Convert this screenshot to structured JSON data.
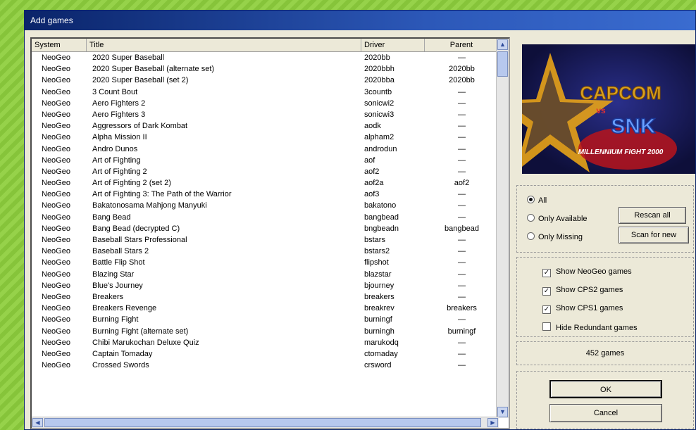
{
  "window": {
    "title": "Add games"
  },
  "list": {
    "columns": [
      "System",
      "Title",
      "Driver",
      "Parent"
    ],
    "rows": [
      {
        "system": "NeoGeo",
        "title": "2020 Super Baseball",
        "driver": "2020bb",
        "parent": "—"
      },
      {
        "system": "NeoGeo",
        "title": "2020 Super Baseball (alternate set)",
        "driver": "2020bbh",
        "parent": "2020bb"
      },
      {
        "system": "NeoGeo",
        "title": "2020 Super Baseball (set 2)",
        "driver": "2020bba",
        "parent": "2020bb"
      },
      {
        "system": "NeoGeo",
        "title": "3 Count Bout",
        "driver": "3countb",
        "parent": "—"
      },
      {
        "system": "NeoGeo",
        "title": "Aero Fighters 2",
        "driver": "sonicwi2",
        "parent": "—"
      },
      {
        "system": "NeoGeo",
        "title": "Aero Fighters 3",
        "driver": "sonicwi3",
        "parent": "—"
      },
      {
        "system": "NeoGeo",
        "title": "Aggressors of Dark Kombat",
        "driver": "aodk",
        "parent": "—"
      },
      {
        "system": "NeoGeo",
        "title": "Alpha Mission II",
        "driver": "alpham2",
        "parent": "—"
      },
      {
        "system": "NeoGeo",
        "title": "Andro Dunos",
        "driver": "androdun",
        "parent": "—"
      },
      {
        "system": "NeoGeo",
        "title": "Art of Fighting",
        "driver": "aof",
        "parent": "—"
      },
      {
        "system": "NeoGeo",
        "title": "Art of Fighting 2",
        "driver": "aof2",
        "parent": "—"
      },
      {
        "system": "NeoGeo",
        "title": "Art of Fighting 2 (set 2)",
        "driver": "aof2a",
        "parent": "aof2"
      },
      {
        "system": "NeoGeo",
        "title": "Art of Fighting 3: The Path of the Warrior",
        "driver": "aof3",
        "parent": "—"
      },
      {
        "system": "NeoGeo",
        "title": "Bakatonosama Mahjong Manyuki",
        "driver": "bakatono",
        "parent": "—"
      },
      {
        "system": "NeoGeo",
        "title": "Bang Bead",
        "driver": "bangbead",
        "parent": "—"
      },
      {
        "system": "NeoGeo",
        "title": "Bang Bead (decrypted C)",
        "driver": "bngbeadn",
        "parent": "bangbead"
      },
      {
        "system": "NeoGeo",
        "title": "Baseball Stars Professional",
        "driver": "bstars",
        "parent": "—"
      },
      {
        "system": "NeoGeo",
        "title": "Baseball Stars 2",
        "driver": "bstars2",
        "parent": "—"
      },
      {
        "system": "NeoGeo",
        "title": "Battle Flip Shot",
        "driver": "flipshot",
        "parent": "—"
      },
      {
        "system": "NeoGeo",
        "title": "Blazing Star",
        "driver": "blazstar",
        "parent": "—"
      },
      {
        "system": "NeoGeo",
        "title": "Blue's Journey",
        "driver": "bjourney",
        "parent": "—"
      },
      {
        "system": "NeoGeo",
        "title": "Breakers",
        "driver": "breakers",
        "parent": "—"
      },
      {
        "system": "NeoGeo",
        "title": "Breakers Revenge",
        "driver": "breakrev",
        "parent": "breakers"
      },
      {
        "system": "NeoGeo",
        "title": "Burning Fight",
        "driver": "burningf",
        "parent": "—"
      },
      {
        "system": "NeoGeo",
        "title": "Burning Fight (alternate set)",
        "driver": "burningh",
        "parent": "burningf"
      },
      {
        "system": "NeoGeo",
        "title": "Chibi Marukochan Deluxe Quiz",
        "driver": "marukodq",
        "parent": "—"
      },
      {
        "system": "NeoGeo",
        "title": "Captain Tomaday",
        "driver": "ctomaday",
        "parent": "—"
      },
      {
        "system": "NeoGeo",
        "title": "Crossed Swords",
        "driver": "crsword",
        "parent": "—"
      }
    ]
  },
  "preview": {
    "logo_top": "CAPCOM",
    "logo_vs": "vs",
    "logo_bottom": "SNK",
    "logo_caption": "MILLENNIUM FIGHT 2000"
  },
  "filter": {
    "options": [
      {
        "label": "All",
        "selected": true
      },
      {
        "label": "Only Available",
        "selected": false
      },
      {
        "label": "Only Missing",
        "selected": false
      }
    ],
    "rescan_label": "Rescan all",
    "scan_new_label": "Scan for new"
  },
  "toggles": [
    {
      "label": "Show NeoGeo games",
      "checked": true
    },
    {
      "label": "Show CPS2 games",
      "checked": true
    },
    {
      "label": "Show CPS1 games",
      "checked": true
    },
    {
      "label": "Hide Redundant games",
      "checked": false
    }
  ],
  "count_label": "452 games",
  "buttons": {
    "ok": "OK",
    "cancel": "Cancel"
  },
  "colors": {
    "titlebar": "#0a246a",
    "logo_star": "#e8a317",
    "logo_text": "#4a7de0"
  }
}
